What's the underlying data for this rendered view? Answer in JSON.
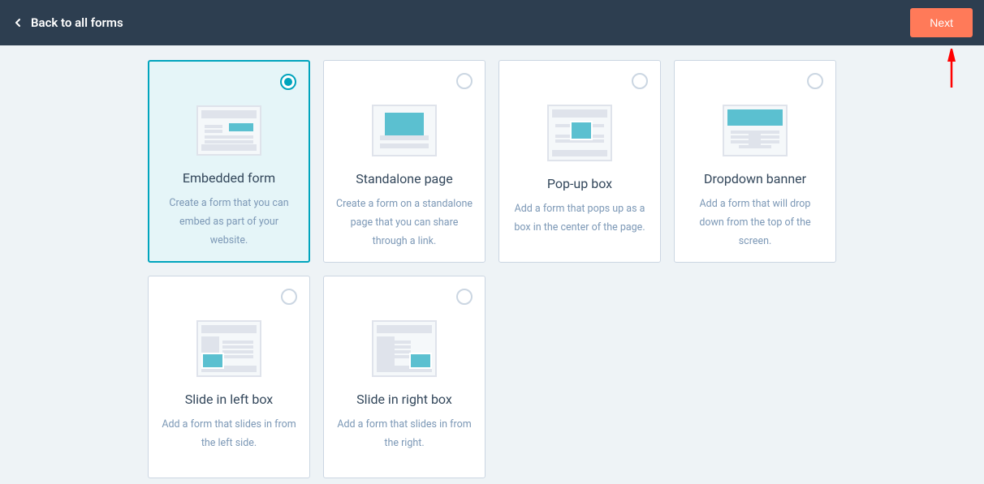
{
  "header": {
    "back_label": "Back to all forms",
    "next_label": "Next"
  },
  "options": [
    {
      "id": "embedded",
      "title": "Embedded form",
      "desc": "Create a form that you can embed as part of your website.",
      "selected": true
    },
    {
      "id": "standalone",
      "title": "Standalone page",
      "desc": "Create a form on a standalone page that you can share through a link.",
      "selected": false
    },
    {
      "id": "popup",
      "title": "Pop-up box",
      "desc": "Add a form that pops up as a box in the center of the page.",
      "selected": false
    },
    {
      "id": "dropdown",
      "title": "Dropdown banner",
      "desc": "Add a form that will drop down from the top of the screen.",
      "selected": false
    },
    {
      "id": "slideleft",
      "title": "Slide in left box",
      "desc": "Add a form that slides in from the left side.",
      "selected": false
    },
    {
      "id": "slideright",
      "title": "Slide in right box",
      "desc": "Add a form that slides in from the right.",
      "selected": false
    }
  ]
}
